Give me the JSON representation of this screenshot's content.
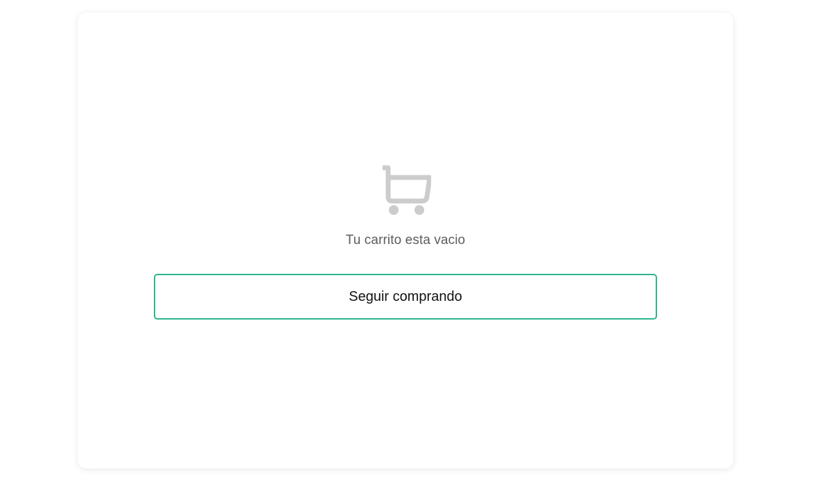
{
  "cart": {
    "icon": "cart-icon",
    "empty_message": "Tu carrito esta vacio",
    "continue_label": "Seguir comprando"
  },
  "colors": {
    "accent": "#2bb58f",
    "icon": "#cccccc",
    "message_text": "#5c5c5c"
  }
}
